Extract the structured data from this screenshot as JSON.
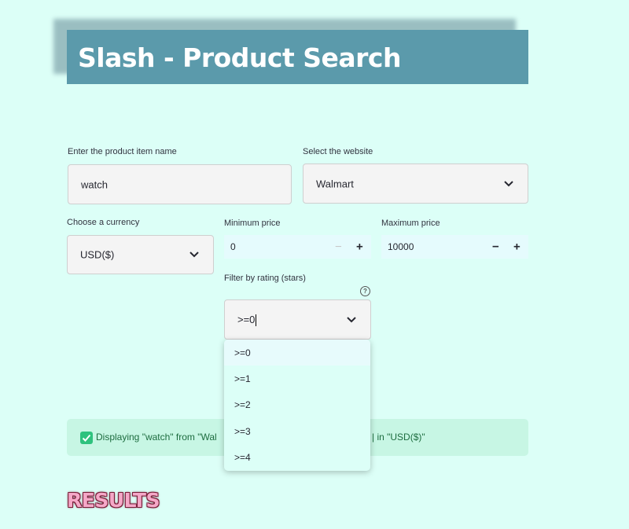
{
  "header": {
    "title": "Slash - Product Search"
  },
  "product_input": {
    "label": "Enter the product item name",
    "value": "watch"
  },
  "website_select": {
    "label": "Select the website",
    "value": "Walmart"
  },
  "currency_select": {
    "label": "Choose a currency",
    "value": "USD($)"
  },
  "min_price": {
    "label": "Minimum price",
    "value": "0",
    "minus": "−",
    "plus": "+"
  },
  "max_price": {
    "label": "Maximum price",
    "value": "10000",
    "minus": "−",
    "plus": "+"
  },
  "rating_filter": {
    "label": "Filter by rating (stars)",
    "help": "?",
    "value": ">=0",
    "options": [
      ">=0",
      ">=1",
      ">=2",
      ">=3",
      ">=4"
    ]
  },
  "success": {
    "message_start": "Displaying \"watch\" from \"Wal",
    "message_end": "| in \"USD($)\""
  },
  "results_heading": "RESULTS",
  "colors": {
    "background": "#dcfff7",
    "header": "#5b9aab",
    "success": "#c7f6e4",
    "check": "#2ec27e"
  }
}
